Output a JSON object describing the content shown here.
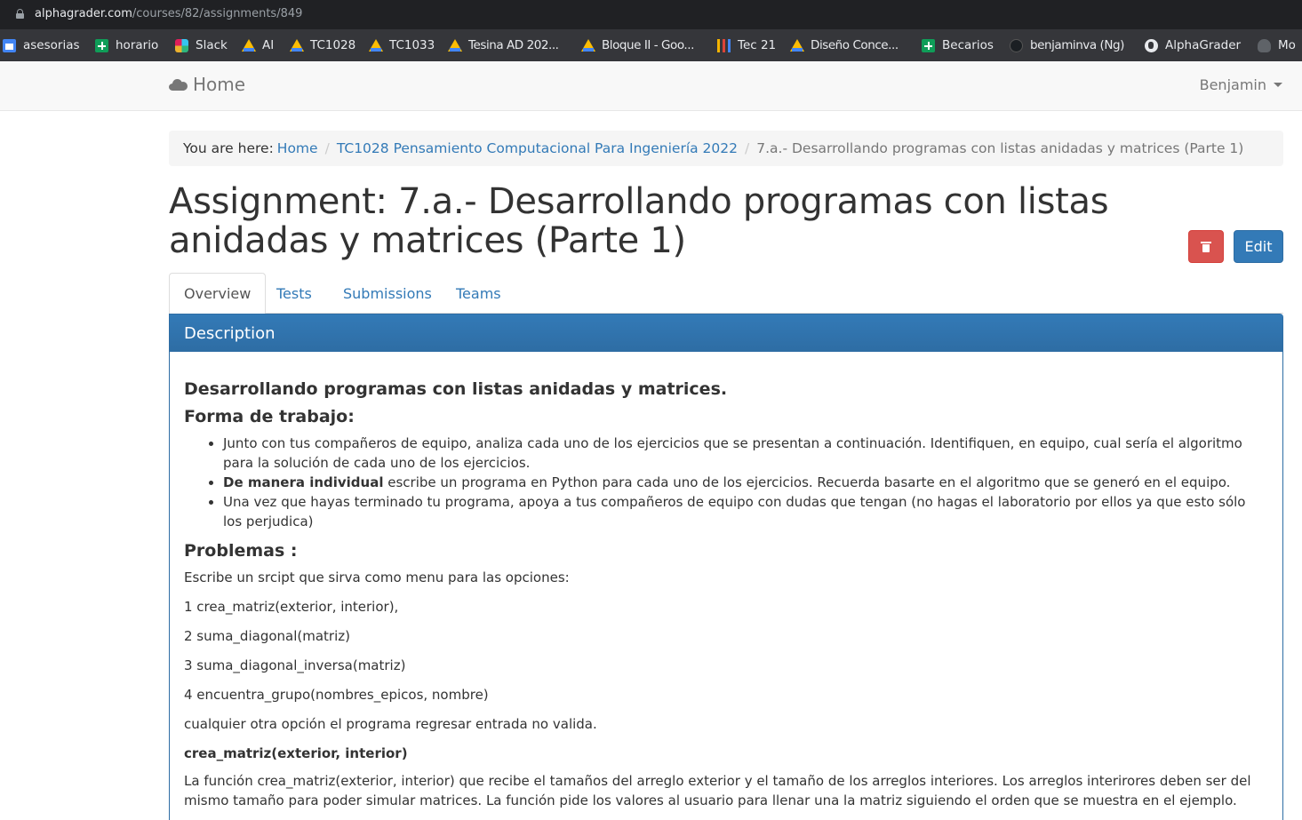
{
  "browser": {
    "url_host": "alphagrader.com",
    "url_path": "/courses/82/assignments/849",
    "bookmarks": [
      {
        "label": "asesorias",
        "icon": "calendar-icon"
      },
      {
        "label": "horario",
        "icon": "sheets-icon"
      },
      {
        "label": "Slack",
        "icon": "slack-icon"
      },
      {
        "label": "AI",
        "icon": "drive-icon"
      },
      {
        "label": "TC1028",
        "icon": "drive-icon"
      },
      {
        "label": "TC1033",
        "icon": "drive-icon"
      },
      {
        "label": "Tesina AD 202...",
        "icon": "drive-icon"
      },
      {
        "label": "Bloque II - Goo...",
        "icon": "drive-icon"
      },
      {
        "label": "Tec 21",
        "icon": "bars-icon"
      },
      {
        "label": "Diseño Conce...",
        "icon": "drive-icon"
      },
      {
        "label": "Becarios",
        "icon": "sheets-icon"
      },
      {
        "label": "benjaminva (Ng)",
        "icon": "github-icon"
      },
      {
        "label": "AlphaGrader",
        "icon": "globe-icon"
      },
      {
        "label": "Mo",
        "icon": "moo-icon"
      }
    ]
  },
  "navbar": {
    "brand": "Home",
    "user": "Benjamin"
  },
  "breadcrumb": {
    "prefix": "You are here:",
    "items": [
      "Home",
      "TC1028 Pensamiento Computacional Para Ingeniería 2022",
      "7.a.- Desarrollando programas con listas anidadas y matrices (Parte 1)"
    ]
  },
  "page": {
    "title": "Assignment: 7.a.- Desarrollando programas con listas anidadas y matrices (Parte 1)",
    "edit_label": "Edit"
  },
  "tabs": [
    "Overview",
    "Tests",
    "Submissions",
    "Teams"
  ],
  "panel": {
    "heading": "Description",
    "h_main": "Desarrollando programas con listas anidadas y matrices.",
    "h_forma": "Forma de trabajo:",
    "bullets": {
      "b1": "Junto con tus compañeros de equipo, analiza cada uno de los ejercicios que se presentan a continuación. Identifiquen, en equipo, cual sería el algoritmo para la solución de cada uno de los ejercicios.",
      "b2_bold": "De manera individual",
      "b2_rest": " escribe un programa en Python para cada uno de los ejercicios. Recuerda basarte en el algoritmo que se generó en el equipo.",
      "b3": "Una vez que hayas terminado tu programa, apoya a tus compañeros de equipo con dudas que tengan (no hagas el laboratorio por ellos ya que esto sólo los perjudica)"
    },
    "h_problemas": "Problemas :",
    "intro": "Escribe un srcipt que sirva como menu para las opciones:",
    "options": [
      "1 crea_matriz(exterior, interior),",
      "2 suma_diagonal(matriz)",
      "3 suma_diagonal_inversa(matriz)",
      "4 encuentra_grupo(nombres_epicos, nombre)"
    ],
    "otherwise": "cualquier otra opción el programa regresar entrada no valida.",
    "signature": "crea_matriz(exterior, interior)",
    "description": "La función crea_matriz(exterior, interior) que recibe el tamaños del arreglo exterior y el tamaño de los arreglos interiores. Los arreglos interirores deben ser del mismo tamaño para poder simular matrices. La función pide los valores al usuario para llenar una la matriz siguiendo el orden que se muestra en el ejemplo."
  }
}
